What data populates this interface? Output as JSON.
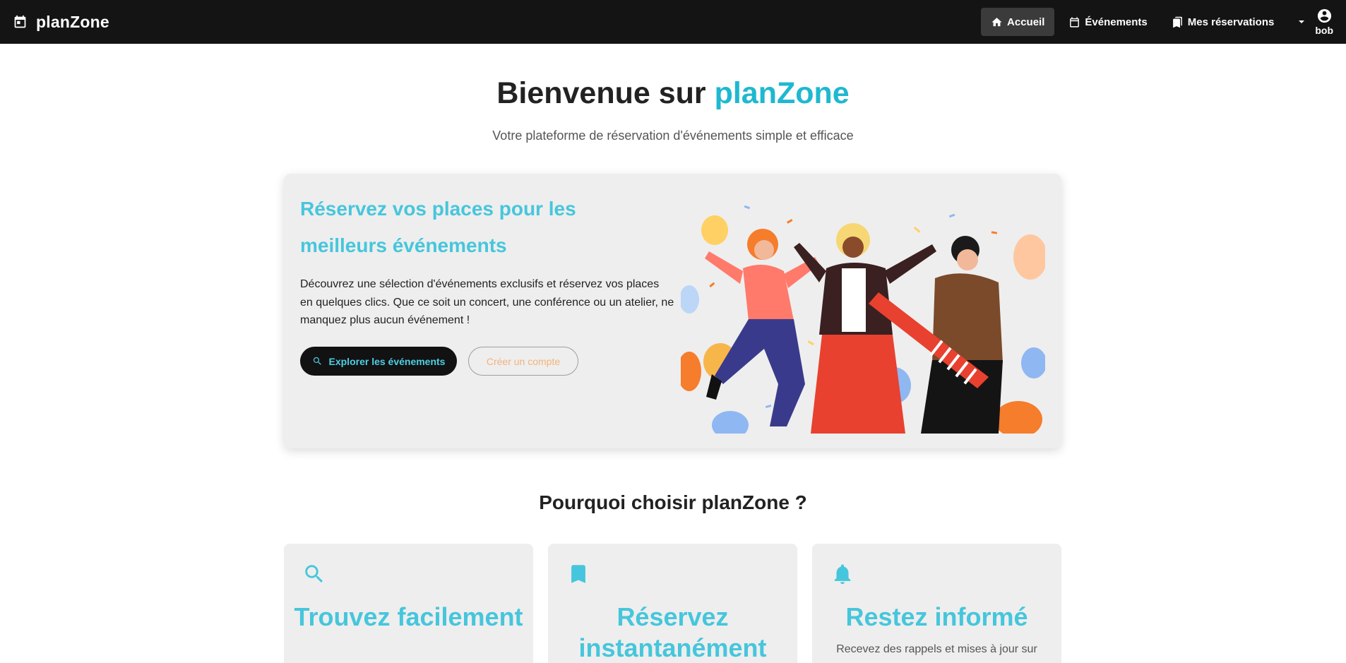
{
  "brand": {
    "name": "planZone",
    "icon": "calendar-icon"
  },
  "nav": {
    "items": [
      {
        "label": "Accueil",
        "icon": "home-icon",
        "active": true
      },
      {
        "label": "Événements",
        "icon": "calendar-icon",
        "active": false
      },
      {
        "label": "Mes réservations",
        "icon": "bookmarks-icon",
        "active": false
      }
    ],
    "user": {
      "name": "bob",
      "icon": "account-circle-icon",
      "menu_icon": "caret-down-icon"
    }
  },
  "hero": {
    "title_prefix": "Bienvenue sur ",
    "title_accent": "planZone",
    "subtitle": "Votre plateforme de réservation d'événements simple et efficace"
  },
  "promo": {
    "heading": "Réservez vos places pour les meilleurs événements",
    "text": "Découvrez une sélection d'événements exclusifs et réservez vos places en quelques clics. Que ce soit un concert, une conférence ou un atelier, ne manquez plus aucun événement !",
    "primary_button": "Explorer les événements",
    "secondary_button": "Créer un compte",
    "illustration": "party-people-illustration"
  },
  "features": {
    "title": "Pourquoi choisir planZone ?",
    "items": [
      {
        "title": "Trouvez facilement",
        "description": "",
        "icon": "search-icon"
      },
      {
        "title": "Réservez instantanément",
        "description": "",
        "icon": "bookmark-icon"
      },
      {
        "title": "Restez informé",
        "description": "Recevez des rappels et mises à jour sur",
        "icon": "bell-icon"
      }
    ]
  },
  "colors": {
    "accent": "#1fb8d0",
    "accent_light": "#46c6dc",
    "navbar": "#141414",
    "card": "#eeeeee",
    "secondary_button_text": "#f5b27a"
  }
}
